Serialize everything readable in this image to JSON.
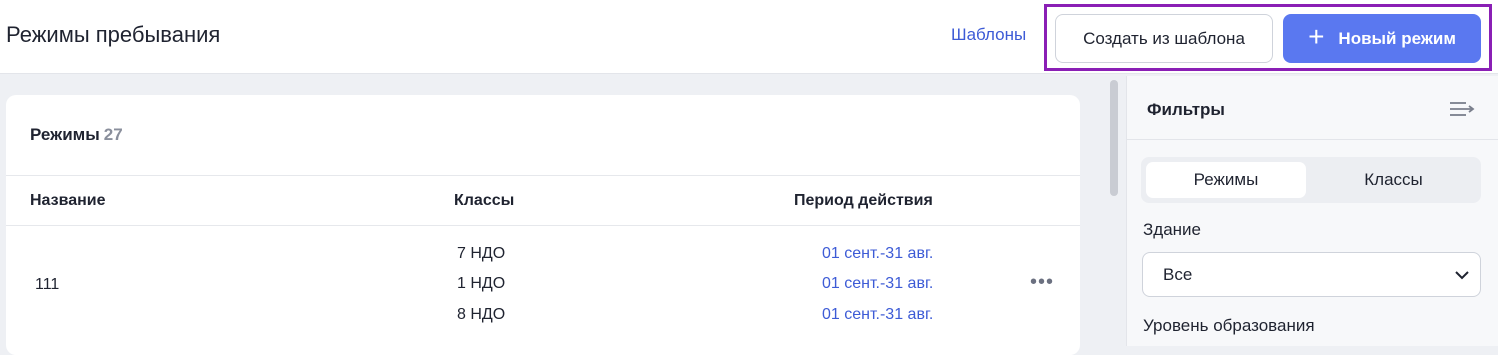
{
  "header": {
    "title": "Режимы пребывания",
    "templates_link": "Шаблоны",
    "create_from_template": "Создать из шаблона",
    "new_mode": "Новый режим",
    "new_mode_icon": "plus-icon",
    "highlight_color": "#8a1fb5",
    "accent_color": "#5a78f0"
  },
  "table": {
    "title": "Режимы",
    "count": "27",
    "columns": [
      "Название",
      "Классы",
      "Период действия"
    ],
    "rows": [
      {
        "name": "111",
        "classes": [
          "7 НДО",
          "1 НДО",
          "8 НДО"
        ],
        "periods": [
          "01 сент.-31 авг.",
          "01 сент.-31 авг.",
          "01 сент.-31 авг."
        ],
        "menu_icon": "more-dots-icon"
      }
    ]
  },
  "filters": {
    "title": "Фильтры",
    "collapse_icon": "collapse-filters-icon",
    "tabs": [
      "Режимы",
      "Классы"
    ],
    "active_tab": "Режимы",
    "building_label": "Здание",
    "building_value": "Все",
    "education_label": "Уровень образования"
  }
}
